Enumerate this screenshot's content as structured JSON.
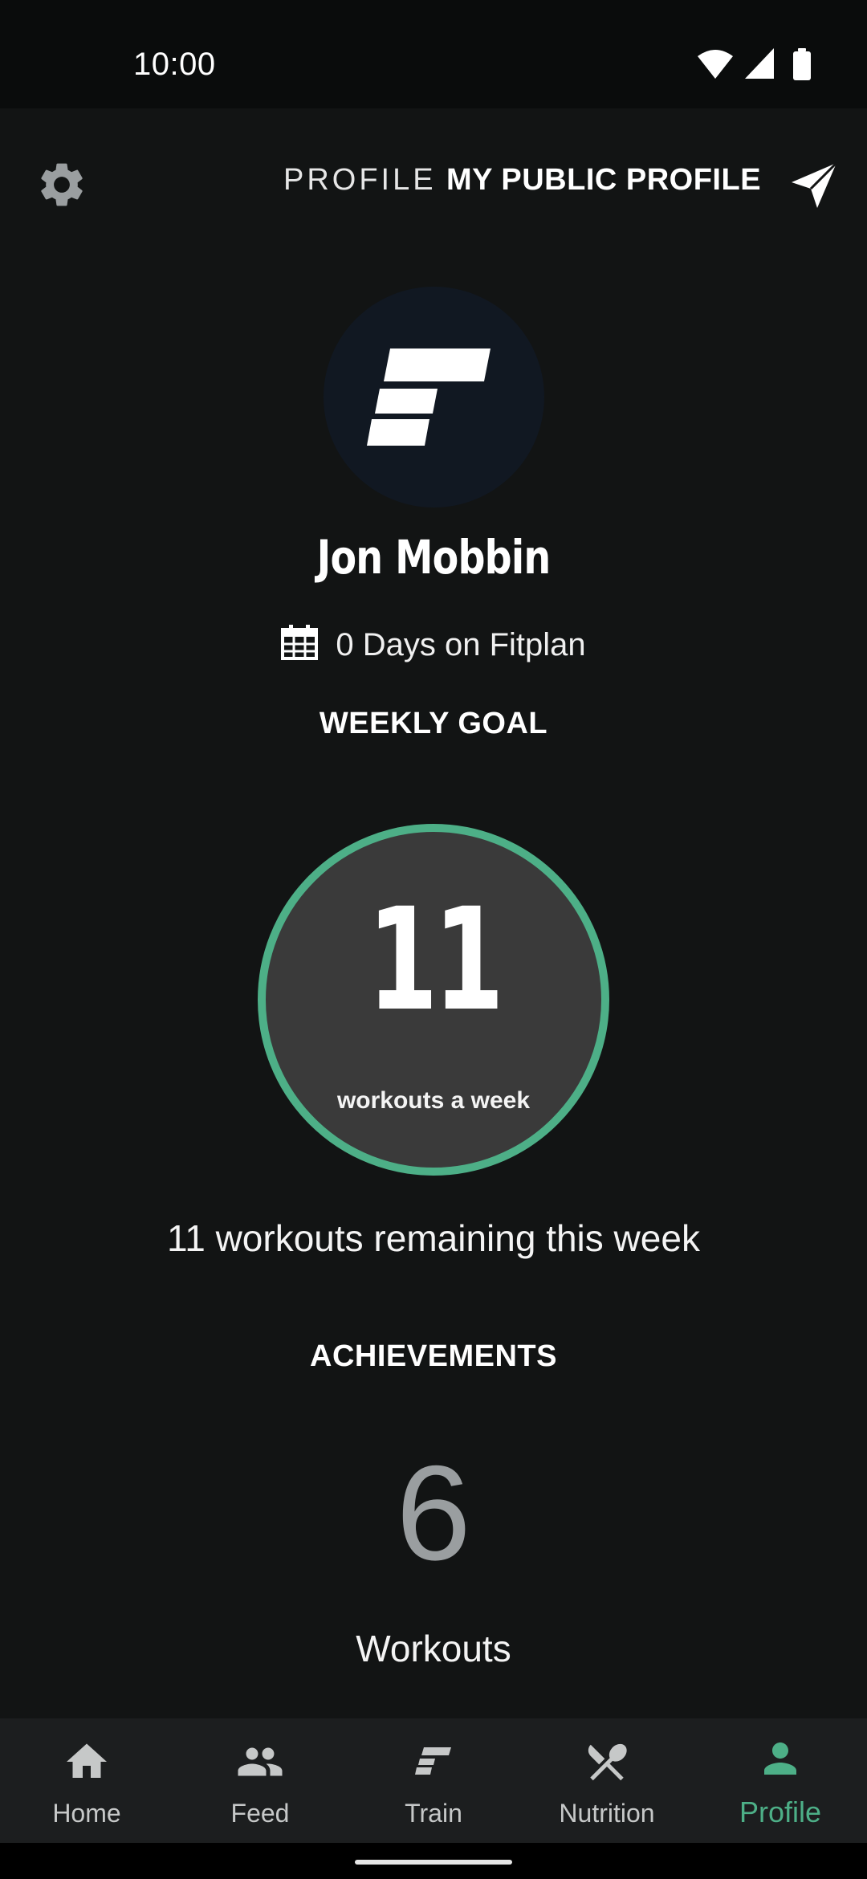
{
  "status_bar": {
    "time": "10:00",
    "icons": [
      "wifi-icon",
      "signal-icon",
      "battery-icon"
    ]
  },
  "header": {
    "settings_icon": "gear-icon",
    "tabs": [
      {
        "label": "PROFILE",
        "active": false
      },
      {
        "label": "MY PUBLIC PROFILE",
        "active": true
      }
    ],
    "share_icon": "send-icon"
  },
  "profile": {
    "avatar_icon": "fitplan-logo-icon",
    "name": "Jon Mobbin",
    "days_icon": "calendar-icon",
    "days_text": "0 Days on Fitplan"
  },
  "weekly_goal": {
    "title": "WEEKLY GOAL",
    "value": "11",
    "caption": "workouts a week",
    "remaining_text": "11 workouts remaining this week"
  },
  "achievements": {
    "title": "ACHIEVEMENTS",
    "value": "6",
    "label": "Workouts"
  },
  "bottom_nav": {
    "items": [
      {
        "label": "Home",
        "icon": "home-icon",
        "active": false
      },
      {
        "label": "Feed",
        "icon": "people-icon",
        "active": false
      },
      {
        "label": "Train",
        "icon": "train-logo-icon",
        "active": false
      },
      {
        "label": "Nutrition",
        "icon": "fork-knife-icon",
        "active": false
      },
      {
        "label": "Profile",
        "icon": "person-icon",
        "active": true
      }
    ]
  },
  "colors": {
    "background": "#121414",
    "accent": "#4daf87",
    "ring_fill": "#3a3a3a",
    "nav_background": "#1c1e1f",
    "nav_inactive": "#c6c8c8",
    "achievement_value": "#9a9ea0"
  }
}
